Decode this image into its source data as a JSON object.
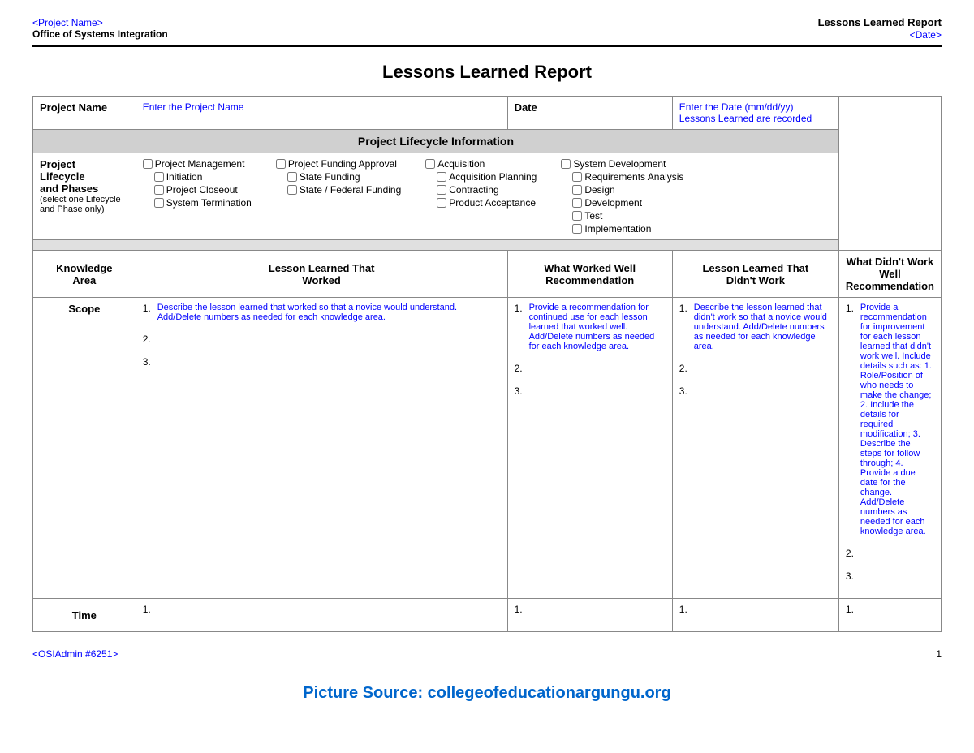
{
  "header": {
    "project_name_link": "<Project Name>",
    "office_name": "Office of Systems Integration",
    "report_title": "Lessons Learned Report",
    "date_link": "<Date>"
  },
  "page_title": "Lessons Learned Report",
  "form": {
    "project_name_label": "Project Name",
    "project_name_placeholder": "Enter the Project Name",
    "date_label": "Date",
    "date_placeholder": "Enter the Date (mm/dd/yy) Lessons Learned are recorded"
  },
  "lifecycle": {
    "section_header": "Project Lifecycle Information",
    "label_line1": "Project",
    "label_line2": "Lifecycle",
    "label_line3": "and Phases",
    "label_sub": "(select one Lifecycle and Phase only)",
    "col1_items": [
      "Project Management",
      "Initiation",
      "Project Closeout",
      "System Termination"
    ],
    "col2_items": [
      "Project Funding Approval",
      "State Funding",
      "State / Federal Funding"
    ],
    "col3_items": [
      "Acquisition",
      "Acquisition Planning",
      "Contracting",
      "Product Acceptance"
    ],
    "col4_items": [
      "System Development",
      "Requirements Analysis",
      "Design",
      "Development",
      "Test",
      "Implementation"
    ]
  },
  "table": {
    "col_headers": [
      "Knowledge\nArea",
      "Lesson Learned That\nWorked",
      "What Worked Well\nRecommendation",
      "Lesson Learned That\nDidn't Work",
      "What Didn't Work Well\nRecommendation"
    ],
    "rows": [
      {
        "area": "Scope",
        "lesson_worked": {
          "item1": "Describe the lesson learned that worked so that a novice would understand. Add/Delete numbers as needed for each knowledge area.",
          "item2": "",
          "item3": ""
        },
        "what_worked_rec": {
          "item1": "Provide a recommendation for continued use for each lesson learned that worked well. Add/Delete numbers as needed for each knowledge area.",
          "item2": "",
          "item3": ""
        },
        "lesson_didnt": {
          "item1": "Describe the lesson learned that didn't work so that a novice would understand. Add/Delete numbers as needed for each knowledge area.",
          "item2": "",
          "item3": ""
        },
        "what_didnt_rec": {
          "item1": "Provide a recommendation for improvement for each lesson learned that didn't work well. Include details such as: 1. Role/Position of who needs to make the change; 2. Include the details for required modification; 3. Describe the steps for follow through; 4. Provide a due date for the change. Add/Delete numbers as needed for each knowledge area.",
          "item2": "",
          "item3": ""
        }
      },
      {
        "area": "Time",
        "lesson_worked": {
          "item1": ""
        },
        "what_worked_rec": {
          "item1": ""
        },
        "lesson_didnt": {
          "item1": ""
        },
        "what_didnt_rec": {
          "item1": ""
        }
      }
    ]
  },
  "footer": {
    "admin_link": "<OSIAdmin #6251>",
    "page_number": "1"
  },
  "picture_source": "Picture Source: collegeofeducationargungu.org"
}
